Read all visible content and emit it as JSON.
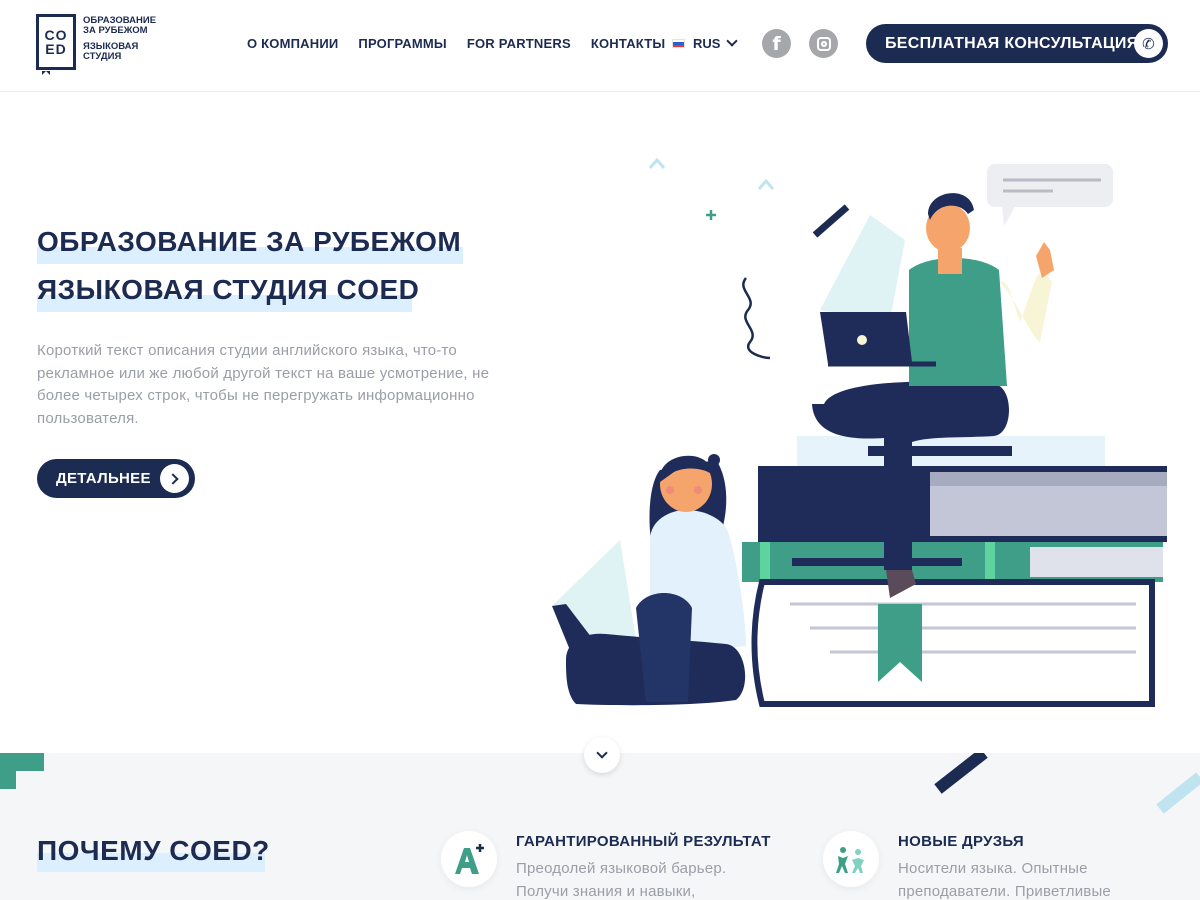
{
  "logo": {
    "mark_top": "CO",
    "mark_bottom": "ED",
    "line1": "ОБРАЗОВАНИЕ",
    "line2": "ЗА РУБЕЖОМ",
    "line3": "ЯЗЫКОВАЯ",
    "line4": "СТУДИЯ"
  },
  "nav": {
    "items": [
      {
        "label": "О КОМПАНИИ"
      },
      {
        "label": "ПРОГРАММЫ"
      },
      {
        "label": "FOR PARTNERS"
      },
      {
        "label": "КОНТАКТЫ"
      }
    ],
    "language": "RUS"
  },
  "social": {
    "facebook_icon": "facebook-icon",
    "instagram_icon": "instagram-icon",
    "facebook_glyph": "f"
  },
  "header_cta": {
    "label": "БЕСПЛАТНАЯ КОНСУЛЬТАЦИЯ",
    "icon": "phone-icon",
    "glyph": "✆"
  },
  "hero": {
    "title_line1": "ОБРАЗОВАНИЕ ЗА РУБЕЖОМ",
    "title_line2": "ЯЗЫКОВАЯ СТУДИЯ COED",
    "description": "Короткий текст описания студии английского языка, что-то рекламное или же любой другой текст на ваше усмотрение, не более четырех строк, чтобы не перегружать информационно пользователя.",
    "button_label": "ДЕТАЛЬНЕЕ"
  },
  "why": {
    "title": "ПОЧЕМУ COED?",
    "features": [
      {
        "icon": "grade-a-plus-icon",
        "title": "ГАРАНТИРОВАННЫЙ РЕЗУЛЬТАТ",
        "text_line1": "Преодолей языковой барьер.",
        "text_line2": "Получи знания и навыки,"
      },
      {
        "icon": "friends-icon",
        "title": "НОВЫЕ ДРУЗЬЯ",
        "text_line1": "Носители языка. Опытные",
        "text_line2": "преподаватели. Приветливые"
      }
    ]
  },
  "colors": {
    "navy": "#1c2b52",
    "accent_green": "#3f9e87",
    "highlight": "#dcefff",
    "muted_text": "#9a9ea6",
    "section_bg": "#f5f6f8"
  }
}
